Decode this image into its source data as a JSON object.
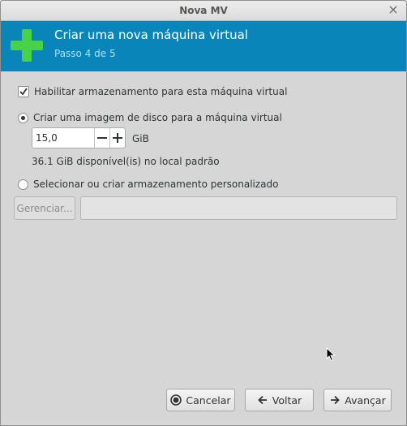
{
  "window": {
    "title": "Nova MV",
    "close_glyph": "×"
  },
  "header": {
    "title": "Criar uma nova máquina virtual",
    "step": "Passo 4 de 5",
    "icon": "plus-icon",
    "icon_color": "#4ad14a",
    "bg_color": "#0a85b9"
  },
  "storage": {
    "enable_label": "Habilitar armazenamento para esta máquina virtual",
    "enable_checked": true,
    "create_disk_label": "Criar uma imagem de disco para a máquina virtual",
    "create_disk_selected": true,
    "size_value": "15,0",
    "unit": "GiB",
    "available": "36.1 GiB disponível(is) no local padrão",
    "custom_label": "Selecionar ou criar armazenamento personalizado",
    "custom_selected": false,
    "manage_label": "Gerenciar...",
    "path_value": ""
  },
  "footer": {
    "cancel_label": "Cancelar",
    "back_label": "Voltar",
    "forward_label": "Avançar"
  }
}
